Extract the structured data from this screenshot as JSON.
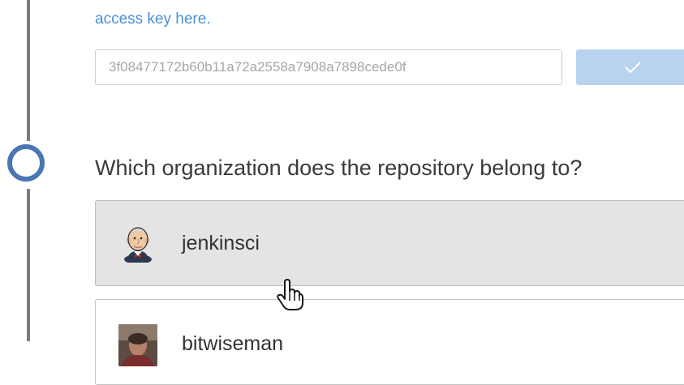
{
  "access_key_link": "access key here.",
  "access_key_input": {
    "value": "3f08477172b60b11a72a2558a7908a7898cede0f",
    "placeholder": ""
  },
  "confirm_button": {
    "icon": "checkmark-icon",
    "color": "#b9d3ef"
  },
  "step_indicator": {
    "icon": "step-circle-icon",
    "color": "#4a77b4"
  },
  "organization_step": {
    "question": "Which organization does the repository belong to?",
    "organizations": [
      {
        "name": "jenkinsci",
        "avatar": "jenkins-butler-avatar",
        "selected": true
      },
      {
        "name": "bitwiseman",
        "avatar": "user-photo-avatar",
        "selected": false
      }
    ]
  },
  "colors": {
    "link": "#4a90d9",
    "selected_background": "#e4e4e4",
    "rail": "#7c7c7c"
  }
}
